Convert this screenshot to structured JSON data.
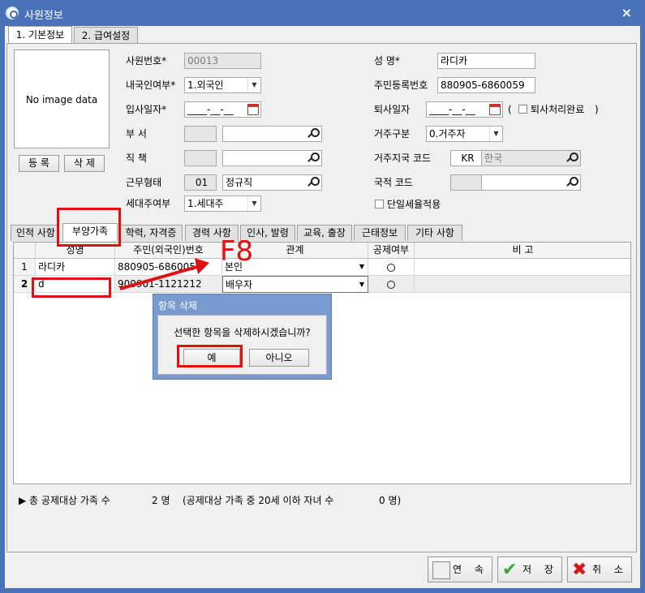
{
  "window": {
    "title": "사원정보",
    "close_symbol": "×"
  },
  "tabs": [
    {
      "label": "1. 기본정보"
    },
    {
      "label": "2. 급여설정"
    }
  ],
  "photo": {
    "placeholder": "No image data"
  },
  "photo_buttons": {
    "register": "등 록",
    "delete": "삭 제"
  },
  "form": {
    "emp_no_label": "사원번호*",
    "emp_no": "00013",
    "domestic_label": "내국인여부*",
    "domestic": "1.외국인",
    "join_date_label": "입사일자*",
    "join_date": "____-__-__",
    "dept_label": "부    서",
    "position_label": "직    책",
    "work_type_label": "근무형태",
    "work_type_code": "01",
    "work_type": "정규직",
    "householder_label": "세대주여부",
    "householder": "1.세대주",
    "name_label": "성    명*",
    "name": "라디카",
    "rrn_label": "주민등록번호",
    "rrn": "880905-6860059",
    "leave_date_label": "퇴사일자",
    "leave_date": "____-__-__",
    "leave_paren_open": "(",
    "leave_done_label": "퇴사처리완료",
    "leave_paren_close": ")",
    "residence_label": "거주구분",
    "residence": "0.거주자",
    "residence_country_label": "거주지국 코드",
    "residence_country_code": "KR",
    "residence_country": "한국",
    "nationality_label": "국적 코드",
    "single_tax_label": "단일세율적용"
  },
  "subtabs": [
    {
      "label": "인적 사항"
    },
    {
      "label": "부양가족"
    },
    {
      "label": "학력, 자격증"
    },
    {
      "label": "경력 사항"
    },
    {
      "label": "인사, 발령"
    },
    {
      "label": "교육, 출장"
    },
    {
      "label": "근태정보"
    },
    {
      "label": "기타 사항"
    }
  ],
  "grid": {
    "headers": [
      "성명",
      "주민(외국인)번호",
      "관계",
      "공제여부",
      "비 고"
    ],
    "rows": [
      {
        "num": "1",
        "name": "라디카",
        "id": "880905-6860059",
        "relation": "본인",
        "deduct": "○",
        "note": ""
      },
      {
        "num": "2",
        "name": "d",
        "id": "900901-1121212",
        "relation": "배우자",
        "deduct": "○",
        "note": ""
      }
    ]
  },
  "footer": {
    "total_label": "▶ 총 공제대상 가족 수",
    "total_value": "2 명",
    "children_label": "(공제대상 가족 중 20세 이하 자녀 수",
    "children_value": "0 명)"
  },
  "actions": {
    "continue": "연 속",
    "save": "저 장",
    "cancel": "취 소"
  },
  "dialog": {
    "title": "항목 삭제",
    "message": "선택한 항목을 삭제하시겠습니까?",
    "yes": "예",
    "no": "아니오"
  },
  "annotation": {
    "f8": "F8"
  },
  "colors": {
    "title_bar": "#4a72b8",
    "annotation_red": "#e01010",
    "dialog_title": "#7a9bd0"
  }
}
